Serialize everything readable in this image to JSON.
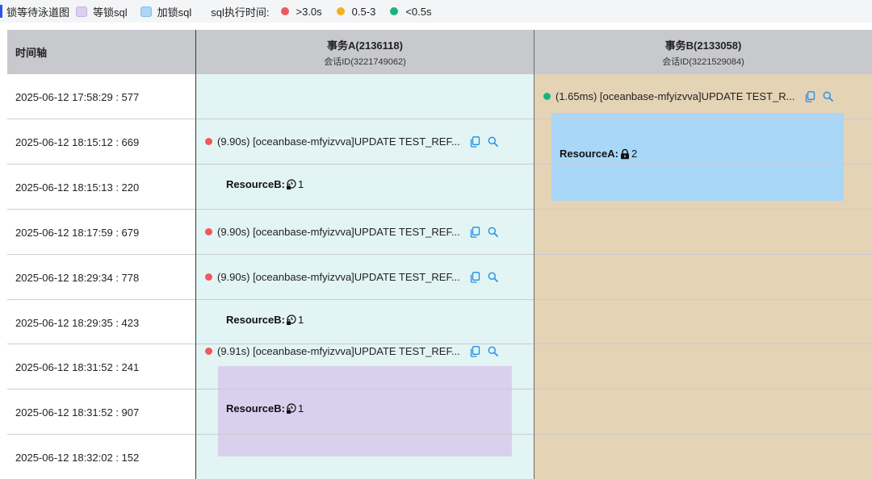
{
  "legend": {
    "title": "锁等待泳道图",
    "wait_label": "等锁sql",
    "lock_label": "加锁sql",
    "time_label": "sql执行时间:",
    "slow_label": ">3.0s",
    "mid_label": "0.5-3",
    "fast_label": "<0.5s"
  },
  "colors": {
    "slow": "#f0595a",
    "mid": "#f6b11c",
    "fast": "#17b57c",
    "wait_block": "#d9d0ed",
    "lock_block": "#a9d7f7",
    "lane_a": "#e2f4f3",
    "lane_b": "#e5d3b5",
    "header": "#c8c9cd",
    "icon_blue": "#1f8fe5"
  },
  "header": {
    "time_axis": "时间轴",
    "tx_a": {
      "title": "事务A(2136118)",
      "session": "会话ID(3221749062)"
    },
    "tx_b": {
      "title": "事务B(2133058)",
      "session": "会话ID(3221529084)"
    }
  },
  "rows": [
    {
      "time": "2025-06-12 17:58:29 : 577"
    },
    {
      "time": "2025-06-12 18:15:12 : 669"
    },
    {
      "time": "2025-06-12 18:15:13 : 220"
    },
    {
      "time": "2025-06-12 18:17:59 : 679"
    },
    {
      "time": "2025-06-12 18:29:34 : 778"
    },
    {
      "time": "2025-06-12 18:29:35 : 423"
    },
    {
      "time": "2025-06-12 18:31:52 : 241"
    },
    {
      "time": "2025-06-12 18:31:52 : 907"
    },
    {
      "time": "2025-06-12 18:32:02 : 152"
    }
  ],
  "lane_a": {
    "sqls": [
      {
        "text": "(9.90s) [oceanbase-mfyizvva]UPDATE TEST_REF...",
        "speed": "slow"
      },
      {
        "text": "(9.90s) [oceanbase-mfyizvva]UPDATE TEST_REF...",
        "speed": "slow"
      },
      {
        "text": "(9.90s) [oceanbase-mfyizvva]UPDATE TEST_REF...",
        "speed": "slow"
      },
      {
        "text": "(9.91s) [oceanbase-mfyizvva]UPDATE TEST_REF...",
        "speed": "slow"
      }
    ],
    "resources": [
      {
        "label": "ResourceB:",
        "count": "1",
        "icon": "lock-clock-icon"
      },
      {
        "label": "ResourceB:",
        "count": "1",
        "icon": "lock-clock-icon"
      },
      {
        "label": "ResourceB:",
        "count": "1",
        "icon": "lock-clock-icon"
      }
    ]
  },
  "lane_b": {
    "sqls": [
      {
        "text": "(1.65ms) [oceanbase-mfyizvva]UPDATE TEST_R...",
        "speed": "fast"
      }
    ],
    "resources": [
      {
        "label": "ResourceA:",
        "count": "2",
        "icon": "lock-icon"
      }
    ]
  }
}
